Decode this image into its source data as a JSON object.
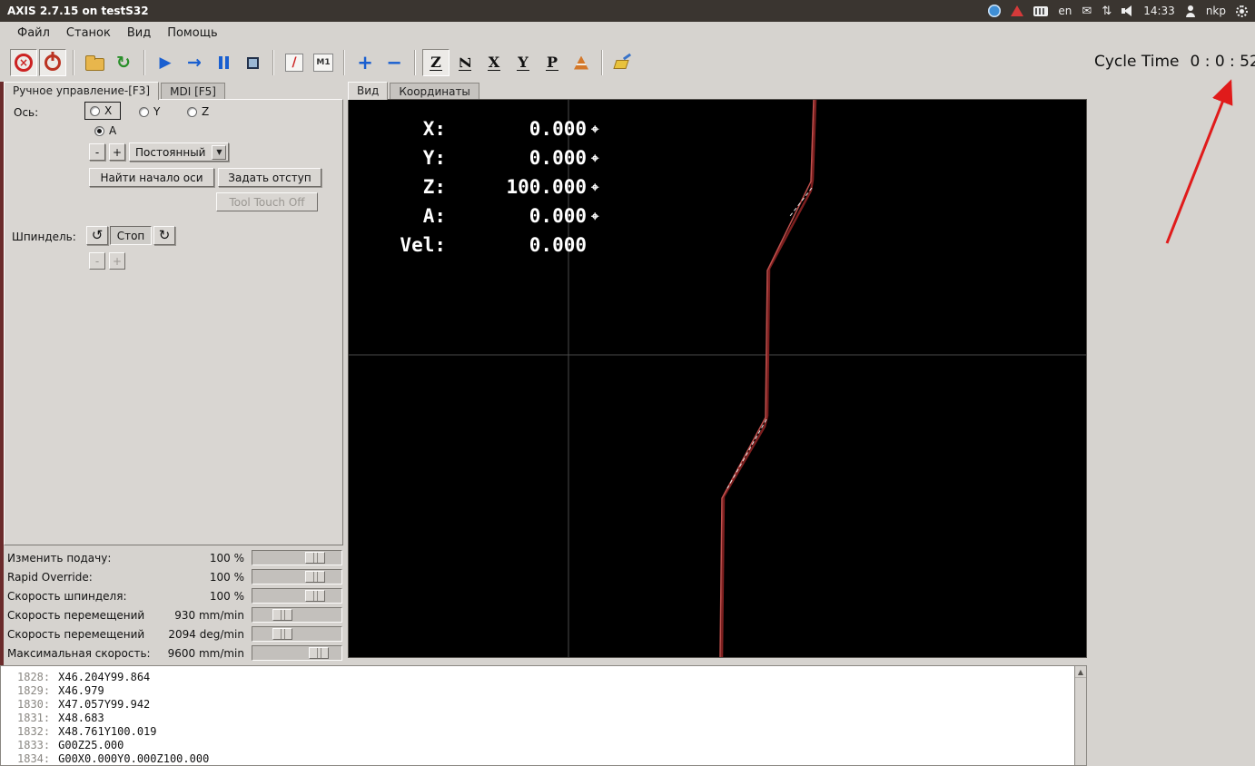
{
  "topbar": {
    "title": "AXIS 2.7.15 on testS32",
    "keyboard_layout": "en",
    "clock": "14:33",
    "user": "nkp"
  },
  "menubar": {
    "items": [
      "Файл",
      "Станок",
      "Вид",
      "Помощь"
    ]
  },
  "toolbar": {
    "estop_glyph": "×",
    "skip_lines": "/",
    "optional_pause": "M1",
    "reload_glyph": "↻",
    "run_glyph": "▶",
    "step_glyph": "→",
    "zoom_in": "+",
    "zoom_out": "−",
    "view_z": "Z",
    "view_z_rot": "Z",
    "view_x": "X",
    "view_y": "Y",
    "view_p": "P",
    "cycle_time_label": "Cycle Time",
    "cycle_time_value": "0 : 0 : 52"
  },
  "manual_panel": {
    "tab_manual": "Ручное управление-[F3]",
    "tab_mdi": "MDI [F5]",
    "axis_label": "Ось:",
    "axis_x": "X",
    "axis_y": "Y",
    "axis_z": "Z",
    "axis_a": "A",
    "jog_minus": "-",
    "jog_plus": "+",
    "jog_mode": "Постоянный",
    "dropdown_arrow": "▼",
    "home_axis_button": "Найти начало оси",
    "set_offset_button": "Задать отступ",
    "tool_touch_off_button": "Tool Touch Off",
    "spindle_label": "Шпиндель:",
    "spindle_ccw_glyph": "↺",
    "spindle_cw_glyph": "↻",
    "spindle_stop_button": "Стоп",
    "spindle_minus": "-",
    "spindle_plus": "+"
  },
  "overrides": [
    {
      "label": "Изменить подачу:",
      "value": "100 %",
      "pos": 58
    },
    {
      "label": "Rapid Override:",
      "value": "100 %",
      "pos": 58
    },
    {
      "label": "Скорость шпинделя:",
      "value": "100 %",
      "pos": 58
    },
    {
      "label": "Скорость перемещений",
      "value": "930 mm/min",
      "pos": 22
    },
    {
      "label": "Скорость перемещений",
      "value": "2094 deg/min",
      "pos": 22
    },
    {
      "label": "Максимальная скорость:",
      "value": "9600 mm/min",
      "pos": 62
    }
  ],
  "preview": {
    "tab_view": "Вид",
    "tab_coords": "Координаты",
    "homed_glyph": "⌖",
    "dro": [
      {
        "label": "X:",
        "value": "0.000"
      },
      {
        "label": "Y:",
        "value": "0.000"
      },
      {
        "label": "Z:",
        "value": "100.000"
      },
      {
        "label": "A:",
        "value": "0.000"
      },
      {
        "label": "Vel:",
        "value": "0.000"
      }
    ]
  },
  "gcode": {
    "lines": [
      {
        "n": "1828:",
        "t": "X46.204Y99.864"
      },
      {
        "n": "1829:",
        "t": "X46.979"
      },
      {
        "n": "1830:",
        "t": "X47.057Y99.942"
      },
      {
        "n": "1831:",
        "t": "X48.683"
      },
      {
        "n": "1832:",
        "t": "X48.761Y100.019"
      },
      {
        "n": "1833:",
        "t": "G00Z25.000"
      },
      {
        "n": "1834:",
        "t": "G00X0.000Y0.000Z100.000"
      }
    ]
  }
}
